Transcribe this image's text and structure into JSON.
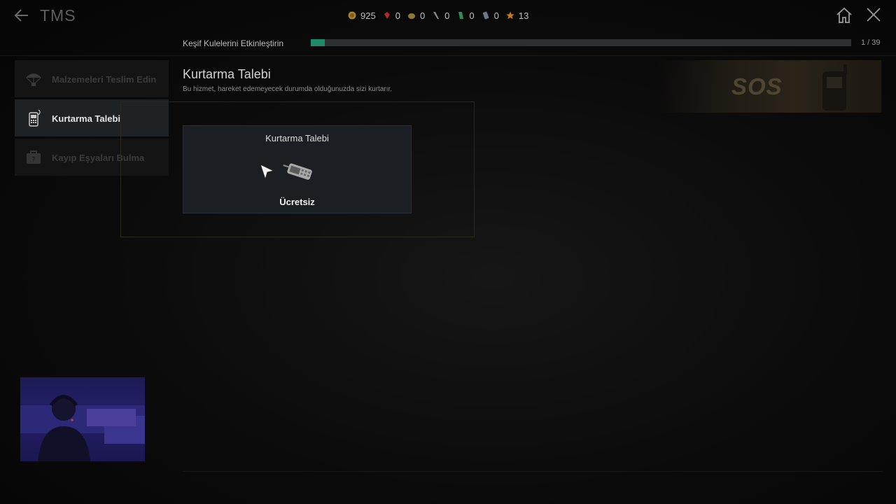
{
  "header": {
    "title": "TMS"
  },
  "resources": [
    {
      "icon": "coin-icon",
      "value": "925",
      "color": "#a8822c"
    },
    {
      "icon": "red-gem-icon",
      "value": "0",
      "color": "#b02a2a"
    },
    {
      "icon": "ore-icon",
      "value": "0",
      "color": "#8a7a3a"
    },
    {
      "icon": "tool-icon",
      "value": "0",
      "color": "#7a7a7a"
    },
    {
      "icon": "green-crystal-icon",
      "value": "0",
      "color": "#2f8a5a"
    },
    {
      "icon": "canister-icon",
      "value": "0",
      "color": "#6b7890"
    },
    {
      "icon": "star-badge-icon",
      "value": "13",
      "color": "#c8782a"
    }
  ],
  "progress": {
    "label": "Keşif Kulelerini Etkinleştirin",
    "count": "1 / 39",
    "fraction": 0.026,
    "color": "#1e8a6a"
  },
  "sidebar": {
    "items": [
      {
        "label": "Malzemeleri Teslim Edin",
        "icon": "parachute-icon",
        "active": false
      },
      {
        "label": "Kurtarma Talebi",
        "icon": "radio-icon",
        "active": true
      },
      {
        "label": "Kayıp Eşyaları Bulma",
        "icon": "lost-items-icon",
        "active": false
      }
    ]
  },
  "main": {
    "title": "Kurtarma Talebi",
    "description": "Bu hizmet, hareket edemeyecek durumda olduğunuzda sizi kurtarır.",
    "banner_text": "SOS",
    "card": {
      "title": "Kurtarma Talebi",
      "price": "Ücretsiz",
      "icon": "radio-device-icon"
    }
  }
}
